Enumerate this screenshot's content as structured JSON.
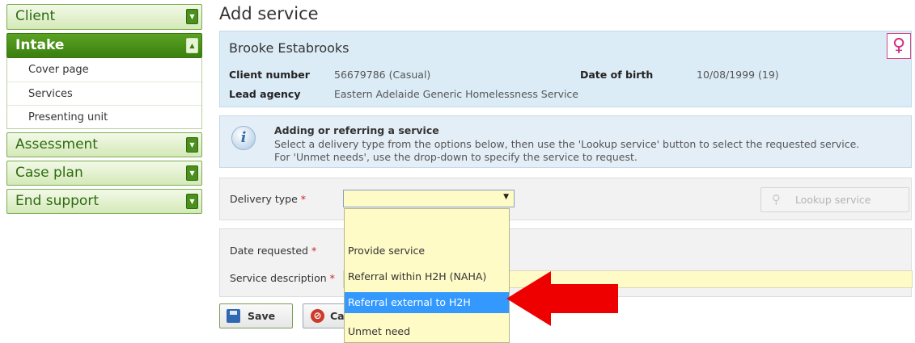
{
  "sidebar": {
    "sections": [
      {
        "label": "Client"
      },
      {
        "label": "Intake",
        "items": [
          "Cover page",
          "Services",
          "Presenting unit"
        ]
      },
      {
        "label": "Assessment"
      },
      {
        "label": "Case plan"
      },
      {
        "label": "End support"
      }
    ]
  },
  "page": {
    "title": "Add service"
  },
  "client": {
    "name": "Brooke Estabrooks",
    "client_number_label": "Client number",
    "client_number_value": "56679786 (Casual)",
    "dob_label": "Date of birth",
    "dob_value": "10/08/1999 (19)",
    "lead_agency_label": "Lead agency",
    "lead_agency_value": "Eastern Adelaide Generic Homelessness Service",
    "gender_icon": "female-icon"
  },
  "info": {
    "title": "Adding or referring a service",
    "line1": "Select a delivery type from the options below, then use the 'Lookup service' button to select the requested service.",
    "line2": "For 'Unmet needs', use the drop-down to specify the service to request."
  },
  "form": {
    "delivery_type_label": "Delivery type",
    "delivery_type_value": "",
    "required_mark": "*",
    "lookup_label": "Lookup service",
    "date_requested_label": "Date requested",
    "service_description_label": "Service description",
    "delivery_options": [
      "",
      "Provide service",
      "Referral within H2H (NAHA)",
      "Referral external to H2H",
      "Unmet need"
    ],
    "selected_option": "Referral external to H2H"
  },
  "actions": {
    "save_label": "Save",
    "cancel_label": "Ca"
  },
  "colors": {
    "accent_green": "#3a7f10",
    "highlight_blue": "#3399ff",
    "arrow_red": "#ee0000"
  }
}
